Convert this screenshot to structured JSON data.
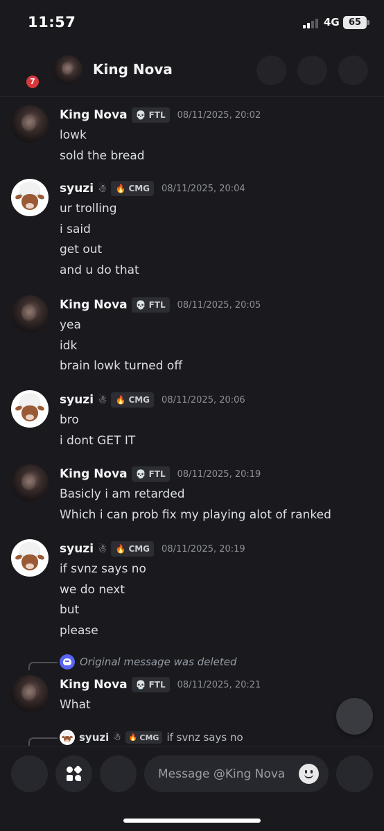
{
  "status_bar": {
    "time": "11:57",
    "network": "4G",
    "battery": "65"
  },
  "header": {
    "title": "King Nova",
    "unread_count": "7"
  },
  "users": {
    "nova": {
      "name": "King Nova",
      "tag": "FTL",
      "tag_icon": "skull-icon"
    },
    "syuzi": {
      "name": "syuzi",
      "badge": "☃",
      "tag": "CMG",
      "tag_icon": "flame-icon"
    }
  },
  "messages": [
    {
      "author": "King Nova",
      "tag": "FTL",
      "time": "08/11/2025, 20:02",
      "lines": [
        "lowk",
        "sold the bread"
      ]
    },
    {
      "author": "syuzi",
      "tag": "CMG",
      "time": "08/11/2025, 20:04",
      "lines": [
        "ur trolling",
        "i said",
        "get out",
        "and u do that"
      ]
    },
    {
      "author": "King Nova",
      "tag": "FTL",
      "time": "08/11/2025, 20:05",
      "lines": [
        "yea",
        "idk",
        "brain lowk turned off"
      ]
    },
    {
      "author": "syuzi",
      "tag": "CMG",
      "time": "08/11/2025, 20:06",
      "lines": [
        "bro",
        "i dont GET IT"
      ]
    },
    {
      "author": "King Nova",
      "tag": "FTL",
      "time": "08/11/2025, 20:19",
      "lines": [
        "Basicly i am retarded",
        "Which i can prob fix my playing alot of ranked"
      ]
    },
    {
      "author": "syuzi",
      "tag": "CMG",
      "time": "08/11/2025, 20:19",
      "lines": [
        "if svnz says no",
        "we do next",
        "but",
        "please"
      ]
    },
    {
      "author": "King Nova",
      "tag": "FTL",
      "time": "08/11/2025, 20:21",
      "lines": [
        "What"
      ]
    }
  ],
  "reply_deleted": {
    "text": "Original message was deleted"
  },
  "reply_preview": {
    "author": "syuzi",
    "tag": "CMG",
    "text": "if svnz says no"
  },
  "composer": {
    "placeholder": "Message @King Nova"
  },
  "colors": {
    "background": "#1a1a1e",
    "blurple": "#5865f2",
    "badge_red": "#da373c"
  }
}
